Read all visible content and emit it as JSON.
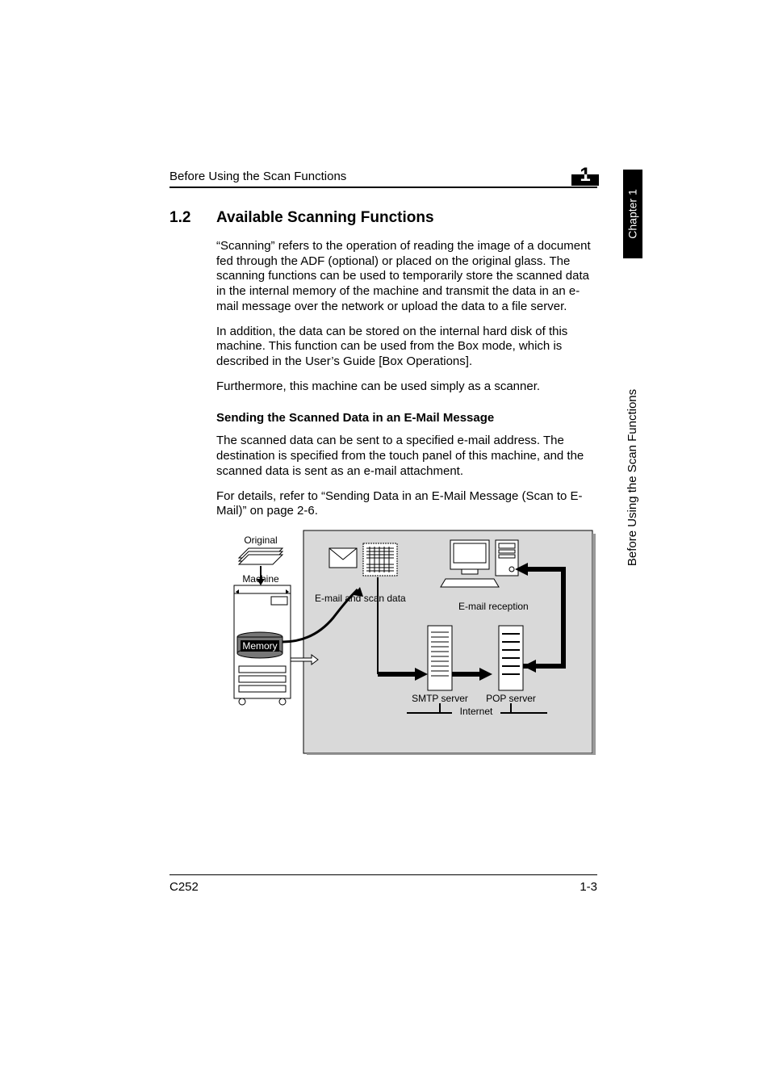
{
  "header": {
    "running_title": "Before Using the Scan Functions",
    "chapter_flag": "1"
  },
  "section": {
    "number": "1.2",
    "title": "Available Scanning Functions",
    "p1": "“Scanning” refers to the operation of reading the image of a document fed through the ADF (optional) or placed on the original glass. The scanning functions can be used to temporarily store the scanned data in the internal memory of the machine and transmit the data in an e-mail message over the network or upload the data to a file server.",
    "p2": "In addition, the data can be stored on the internal hard disk of this machine. This function can be used from the Box mode, which is described in the User’s Guide [Box Operations].",
    "p3": "Furthermore, this machine can be used simply as a scanner.",
    "subhead": "Sending the Scanned Data in an E-Mail Message",
    "p4": "The scanned data can be sent to a specified e-mail address. The destination is specified from the touch panel of this machine, and the scanned data is sent as an e-mail attachment.",
    "p5": "For details, refer to “Sending Data in an E-Mail Message (Scan to E-Mail)” on page 2-6."
  },
  "diagram": {
    "original": "Original",
    "machine": "Machine",
    "memory": "Memory",
    "email_scan_data": "E-mail and scan data",
    "email_reception": "E-mail reception",
    "smtp": "SMTP server",
    "pop": "POP server",
    "internet": "Internet"
  },
  "side": {
    "tab": "Chapter 1",
    "text": "Before Using the Scan Functions"
  },
  "footer": {
    "model": "C252",
    "page": "1-3"
  }
}
